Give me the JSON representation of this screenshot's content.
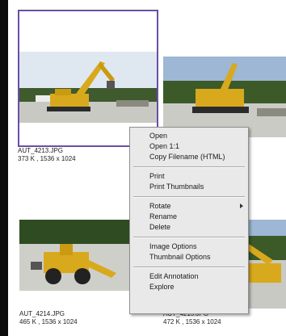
{
  "thumbnails": [
    {
      "filename": "AUT_4213.JPG",
      "info": "373 K , 1536 x 1024",
      "selected": true
    },
    {
      "filename": "",
      "info": "",
      "selected": false
    },
    {
      "filename": "AUT_4214.JPG",
      "info": "465 K , 1536 x 1024",
      "selected": false
    },
    {
      "filename": "AUT_4215.JPG",
      "info": "472 K , 1536 x 1024",
      "selected": false
    }
  ],
  "context_menu": {
    "items": [
      {
        "label": "Open"
      },
      {
        "label": "Open 1:1"
      },
      {
        "label": "Copy Filename (HTML)"
      },
      {
        "label": "Print"
      },
      {
        "label": "Print Thumbnails"
      },
      {
        "label": "Rotate",
        "submenu": true
      },
      {
        "label": "Rename"
      },
      {
        "label": "Delete"
      },
      {
        "label": "Image Options"
      },
      {
        "label": "Thumbnail Options"
      },
      {
        "label": "Edit Annotation"
      },
      {
        "label": "Explore"
      }
    ]
  },
  "colors": {
    "selection_border": "#6a4fa6",
    "menu_background": "#e9e9e9",
    "excavator_yellow": "#d8a91c"
  }
}
